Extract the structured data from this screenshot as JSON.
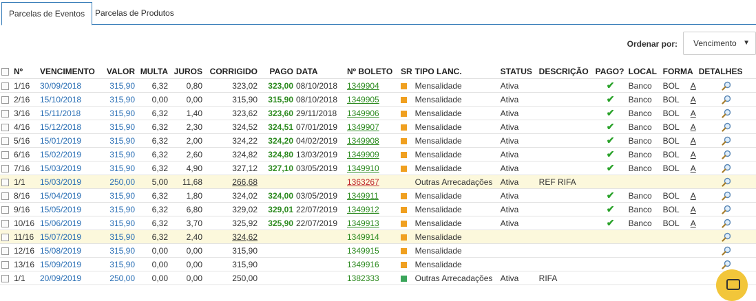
{
  "tabs": [
    "Parcelas de Eventos",
    "Parcelas de Produtos"
  ],
  "order": {
    "label": "Ordenar por:",
    "value": "Vencimento"
  },
  "headers": [
    "Nº",
    "VENCIMENTO",
    "VALOR",
    "MULTA",
    "JUROS",
    "CORRIGIDO",
    "PAGO",
    "DATA",
    "Nº BOLETO",
    "SR",
    "TIPO LANC.",
    "STATUS",
    "DESCRIÇÃO",
    "PAGO?",
    "LOCAL",
    "FORMA",
    "DETALHES"
  ],
  "colors": {
    "sr_orange": "#f0a020",
    "sr_green": "#3aa55a",
    "highlight": "#fcf8dc"
  },
  "rows": [
    {
      "n": "1/16",
      "venc": "30/09/2018",
      "valor": "315,90",
      "multa": "6,32",
      "juros": "0,80",
      "corr": "323,02",
      "pago": "323,00",
      "data": "08/10/2018",
      "boleto": "1349904",
      "sr": "orange",
      "tipo": "Mensalidade",
      "status": "Ativa",
      "desc": "",
      "paid": true,
      "local": "Banco",
      "forma": "BOL",
      "a": "A",
      "hl": false,
      "bstyle": "link",
      "cu": false
    },
    {
      "n": "2/16",
      "venc": "15/10/2018",
      "valor": "315,90",
      "multa": "0,00",
      "juros": "0,00",
      "corr": "315,90",
      "pago": "315,90",
      "data": "08/10/2018",
      "boleto": "1349905",
      "sr": "orange",
      "tipo": "Mensalidade",
      "status": "Ativa",
      "desc": "",
      "paid": true,
      "local": "Banco",
      "forma": "BOL",
      "a": "A",
      "hl": false,
      "bstyle": "link",
      "cu": false
    },
    {
      "n": "3/16",
      "venc": "15/11/2018",
      "valor": "315,90",
      "multa": "6,32",
      "juros": "1,40",
      "corr": "323,62",
      "pago": "323,60",
      "data": "29/11/2018",
      "boleto": "1349906",
      "sr": "orange",
      "tipo": "Mensalidade",
      "status": "Ativa",
      "desc": "",
      "paid": true,
      "local": "Banco",
      "forma": "BOL",
      "a": "A",
      "hl": false,
      "bstyle": "link",
      "cu": false
    },
    {
      "n": "4/16",
      "venc": "15/12/2018",
      "valor": "315,90",
      "multa": "6,32",
      "juros": "2,30",
      "corr": "324,52",
      "pago": "324,51",
      "data": "07/01/2019",
      "boleto": "1349907",
      "sr": "orange",
      "tipo": "Mensalidade",
      "status": "Ativa",
      "desc": "",
      "paid": true,
      "local": "Banco",
      "forma": "BOL",
      "a": "A",
      "hl": false,
      "bstyle": "link",
      "cu": false
    },
    {
      "n": "5/16",
      "venc": "15/01/2019",
      "valor": "315,90",
      "multa": "6,32",
      "juros": "2,00",
      "corr": "324,22",
      "pago": "324,20",
      "data": "04/02/2019",
      "boleto": "1349908",
      "sr": "orange",
      "tipo": "Mensalidade",
      "status": "Ativa",
      "desc": "",
      "paid": true,
      "local": "Banco",
      "forma": "BOL",
      "a": "A",
      "hl": false,
      "bstyle": "link",
      "cu": false
    },
    {
      "n": "6/16",
      "venc": "15/02/2019",
      "valor": "315,90",
      "multa": "6,32",
      "juros": "2,60",
      "corr": "324,82",
      "pago": "324,80",
      "data": "13/03/2019",
      "boleto": "1349909",
      "sr": "orange",
      "tipo": "Mensalidade",
      "status": "Ativa",
      "desc": "",
      "paid": true,
      "local": "Banco",
      "forma": "BOL",
      "a": "A",
      "hl": false,
      "bstyle": "link",
      "cu": false
    },
    {
      "n": "7/16",
      "venc": "15/03/2019",
      "valor": "315,90",
      "multa": "6,32",
      "juros": "4,90",
      "corr": "327,12",
      "pago": "327,10",
      "data": "03/05/2019",
      "boleto": "1349910",
      "sr": "orange",
      "tipo": "Mensalidade",
      "status": "Ativa",
      "desc": "",
      "paid": true,
      "local": "Banco",
      "forma": "BOL",
      "a": "A",
      "hl": false,
      "bstyle": "link",
      "cu": false
    },
    {
      "n": "1/1",
      "venc": "15/03/2019",
      "valor": "250,00",
      "multa": "5,00",
      "juros": "11,68",
      "corr": "266,68",
      "pago": "",
      "data": "",
      "boleto": "1363267",
      "sr": "none",
      "tipo": "Outras Arrecadações",
      "status": "Ativa",
      "desc": "REF RIFA",
      "paid": false,
      "local": "",
      "forma": "",
      "a": "",
      "hl": true,
      "bstyle": "red",
      "cu": true
    },
    {
      "n": "8/16",
      "venc": "15/04/2019",
      "valor": "315,90",
      "multa": "6,32",
      "juros": "1,80",
      "corr": "324,02",
      "pago": "324,00",
      "data": "03/05/2019",
      "boleto": "1349911",
      "sr": "orange",
      "tipo": "Mensalidade",
      "status": "Ativa",
      "desc": "",
      "paid": true,
      "local": "Banco",
      "forma": "BOL",
      "a": "A",
      "hl": false,
      "bstyle": "link",
      "cu": false
    },
    {
      "n": "9/16",
      "venc": "15/05/2019",
      "valor": "315,90",
      "multa": "6,32",
      "juros": "6,80",
      "corr": "329,02",
      "pago": "329,01",
      "data": "22/07/2019",
      "boleto": "1349912",
      "sr": "orange",
      "tipo": "Mensalidade",
      "status": "Ativa",
      "desc": "",
      "paid": true,
      "local": "Banco",
      "forma": "BOL",
      "a": "A",
      "hl": false,
      "bstyle": "link",
      "cu": false
    },
    {
      "n": "10/16",
      "venc": "15/06/2019",
      "valor": "315,90",
      "multa": "6,32",
      "juros": "3,70",
      "corr": "325,92",
      "pago": "325,90",
      "data": "22/07/2019",
      "boleto": "1349913",
      "sr": "orange",
      "tipo": "Mensalidade",
      "status": "Ativa",
      "desc": "",
      "paid": true,
      "local": "Banco",
      "forma": "BOL",
      "a": "A",
      "hl": false,
      "bstyle": "link",
      "cu": false
    },
    {
      "n": "11/16",
      "venc": "15/07/2019",
      "valor": "315,90",
      "multa": "6,32",
      "juros": "2,40",
      "corr": "324,62",
      "pago": "",
      "data": "",
      "boleto": "1349914",
      "sr": "orange",
      "tipo": "Mensalidade",
      "status": "",
      "desc": "",
      "paid": false,
      "local": "",
      "forma": "",
      "a": "",
      "hl": true,
      "bstyle": "plain",
      "cu": true
    },
    {
      "n": "12/16",
      "venc": "15/08/2019",
      "valor": "315,90",
      "multa": "0,00",
      "juros": "0,00",
      "corr": "315,90",
      "pago": "",
      "data": "",
      "boleto": "1349915",
      "sr": "orange",
      "tipo": "Mensalidade",
      "status": "",
      "desc": "",
      "paid": false,
      "local": "",
      "forma": "",
      "a": "",
      "hl": false,
      "bstyle": "plain",
      "cu": false
    },
    {
      "n": "13/16",
      "venc": "15/09/2019",
      "valor": "315,90",
      "multa": "0,00",
      "juros": "0,00",
      "corr": "315,90",
      "pago": "",
      "data": "",
      "boleto": "1349916",
      "sr": "orange",
      "tipo": "Mensalidade",
      "status": "",
      "desc": "",
      "paid": false,
      "local": "",
      "forma": "",
      "a": "",
      "hl": false,
      "bstyle": "plain",
      "cu": false
    },
    {
      "n": "1/1",
      "venc": "20/09/2019",
      "valor": "250,00",
      "multa": "0,00",
      "juros": "0,00",
      "corr": "250,00",
      "pago": "",
      "data": "",
      "boleto": "1382333",
      "sr": "green",
      "tipo": "Outras Arrecadações",
      "status": "Ativa",
      "desc": "RIFA",
      "paid": false,
      "local": "",
      "forma": "",
      "a": "",
      "hl": false,
      "bstyle": "plain",
      "cu": false
    }
  ]
}
